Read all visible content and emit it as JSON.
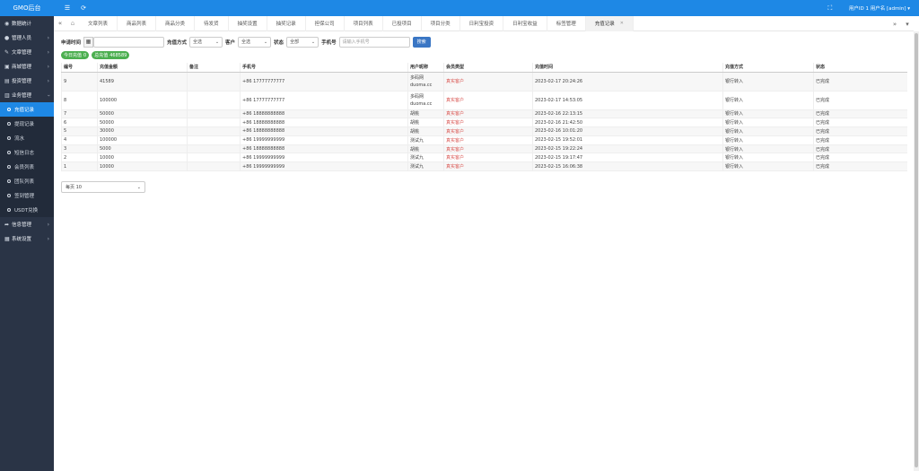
{
  "brand": "GMO后台",
  "sidebar": {
    "items": [
      {
        "icon": "dashboard",
        "label": "数据统计",
        "expandable": false
      },
      {
        "icon": "user",
        "label": "管理人员",
        "expandable": true
      },
      {
        "icon": "edit",
        "label": "文章管理",
        "expandable": true
      },
      {
        "icon": "cart",
        "label": "商城管理",
        "expandable": true
      },
      {
        "icon": "folder",
        "label": "投资管理",
        "expandable": true
      },
      {
        "icon": "briefcase",
        "label": "业务管理",
        "expandable": true,
        "open": true
      }
    ],
    "submenu": [
      {
        "label": "充值记录",
        "active": true
      },
      {
        "label": "提现记录"
      },
      {
        "label": "流水"
      },
      {
        "label": "短信日志"
      },
      {
        "label": "会员列表"
      },
      {
        "label": "团队列表"
      },
      {
        "label": "签到管理"
      },
      {
        "label": "USDT兑换"
      }
    ],
    "items_after": [
      {
        "icon": "share",
        "label": "信息管理",
        "expandable": true
      },
      {
        "icon": "grid",
        "label": "系统设置",
        "expandable": true
      }
    ]
  },
  "topbar": {
    "menu_icon": "☰",
    "refresh_icon": "⟳",
    "fullscreen_icon": "⛶",
    "user_label": "用户ID 1 用户名 [admin]",
    "caret": "▾"
  },
  "tabs": {
    "prev_icon": "«",
    "home_icon": "⌂",
    "next_icon": "»",
    "items": [
      {
        "label": "文章列表"
      },
      {
        "label": "商品列表"
      },
      {
        "label": "商品分类"
      },
      {
        "label": "待发货"
      },
      {
        "label": "抽奖设置"
      },
      {
        "label": "抽奖记录"
      },
      {
        "label": "担保公司"
      },
      {
        "label": "项目列表"
      },
      {
        "label": "已投项目"
      },
      {
        "label": "项目分类"
      },
      {
        "label": "日利宝投资"
      },
      {
        "label": "日利宝收益"
      },
      {
        "label": "标签管理"
      },
      {
        "label": "充值记录",
        "active": true,
        "closable": true
      }
    ]
  },
  "filters": {
    "time_label": "申请时间",
    "time_value": "",
    "method_label": "充值方式",
    "method_value": "全选",
    "client_label": "客户",
    "client_value": "全选",
    "status_label": "状态",
    "status_value": "全部",
    "phone_label": "手机号",
    "phone_placeholder": "请输入手机号",
    "search_button": "搜索"
  },
  "badges": [
    {
      "label": "今日充值",
      "value": "0"
    },
    {
      "label": "总充值",
      "value": "468589"
    }
  ],
  "table": {
    "headers": [
      "编号",
      "充值金额",
      "备注",
      "手机号",
      "用户昵称",
      "会员类型",
      "充值时间",
      "充值方式",
      "状态"
    ],
    "rows": [
      [
        "9",
        "41589",
        "",
        "+86 17777777777",
        "多码网\nduoma.cc",
        "真实客户",
        "2023-02-17 20:24:26",
        "银行转入",
        "已完成"
      ],
      [
        "8",
        "100000",
        "",
        "+86 17777777777",
        "多码网\nduoma.cc",
        "真实客户",
        "2023-02-17 14:53:05",
        "银行转入",
        "已完成"
      ],
      [
        "7",
        "50000",
        "",
        "+86 18888888888",
        "胡桃",
        "真实客户",
        "2023-02-16 22:13:15",
        "银行转入",
        "已完成"
      ],
      [
        "6",
        "50000",
        "",
        "+86 18888888888",
        "胡桃",
        "真实客户",
        "2023-02-16 21:42:50",
        "银行转入",
        "已完成"
      ],
      [
        "5",
        "30000",
        "",
        "+86 18888888888",
        "胡桃",
        "真实客户",
        "2023-02-16 10:01:20",
        "银行转入",
        "已完成"
      ],
      [
        "4",
        "100000",
        "",
        "+86 19999999999",
        "测试九",
        "真实客户",
        "2023-02-15 19:52:01",
        "银行转入",
        "已完成"
      ],
      [
        "3",
        "5000",
        "",
        "+86 18888888888",
        "胡桃",
        "真实客户",
        "2023-02-15 19:22:24",
        "银行转入",
        "已完成"
      ],
      [
        "2",
        "10000",
        "",
        "+86 19999999999",
        "测试九",
        "真实客户",
        "2023-02-15 19:17:47",
        "银行转入",
        "已完成"
      ],
      [
        "1",
        "10000",
        "",
        "+86 19999999999",
        "测试九",
        "真实客户",
        "2023-02-15 16:06:38",
        "银行转入",
        "已完成"
      ]
    ]
  },
  "pager": {
    "label": "每页 10"
  },
  "colors": {
    "primary": "#1e88e5",
    "sidebar": "#2a3446",
    "badge": "#4caf50",
    "red": "#d9534f"
  }
}
